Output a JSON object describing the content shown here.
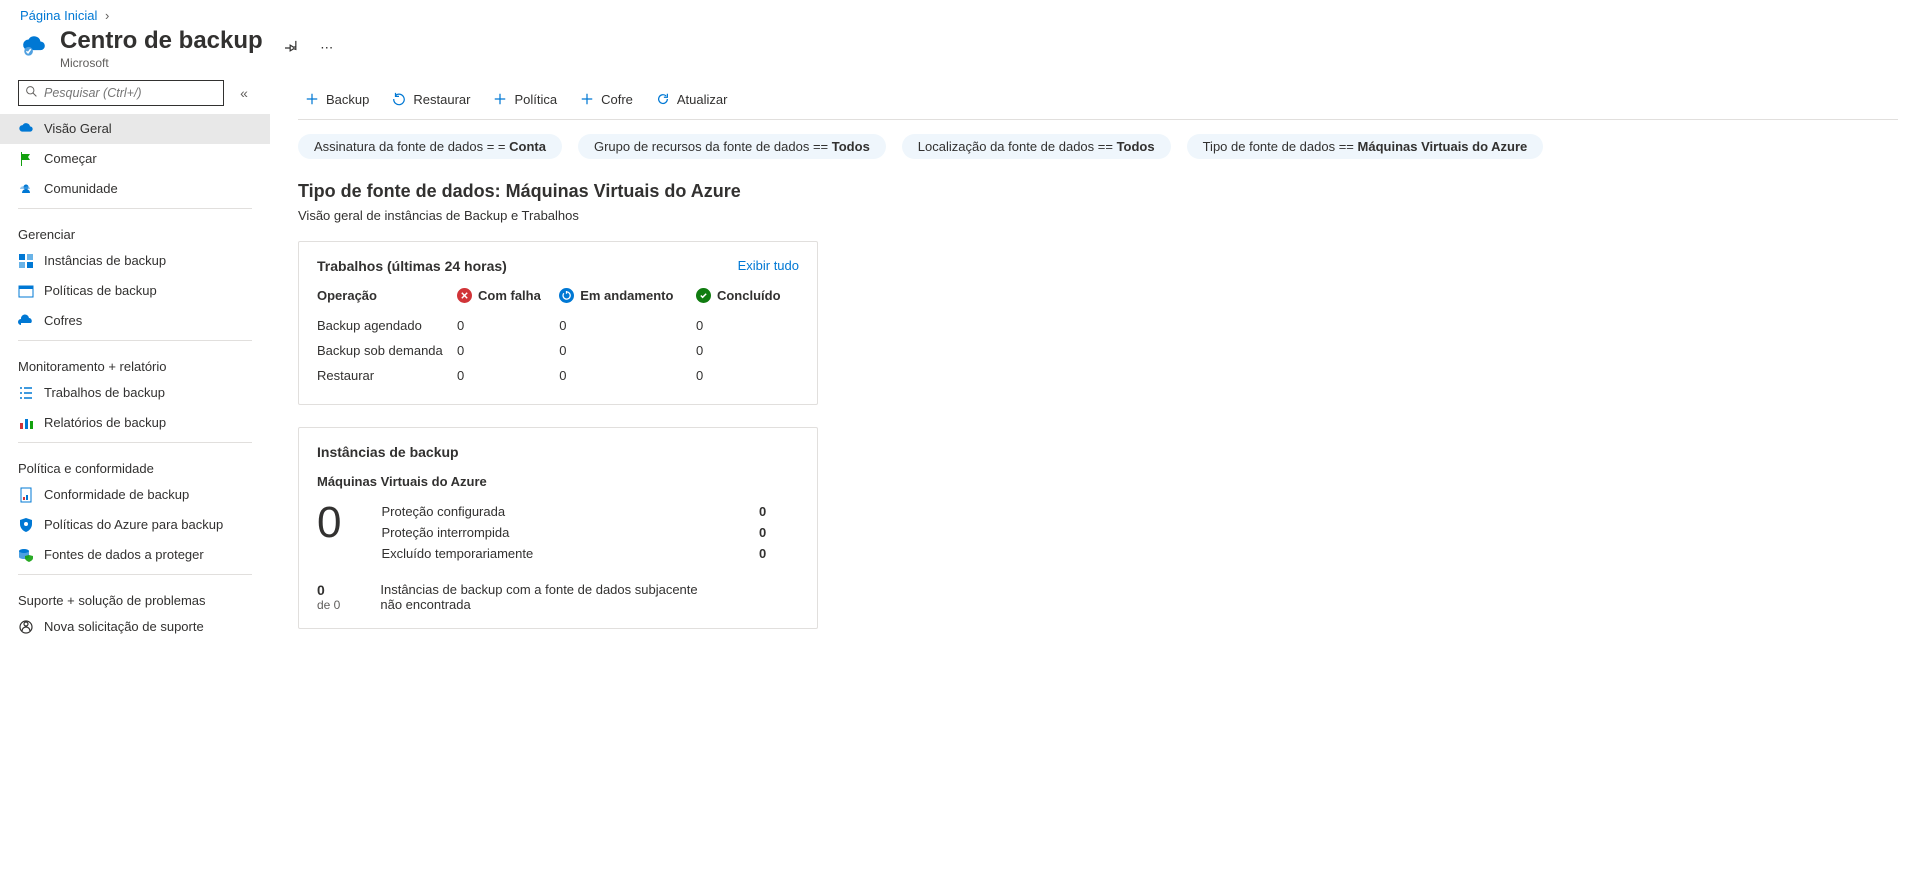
{
  "breadcrumb": {
    "home": "Página Inicial"
  },
  "header": {
    "title": "Centro de backup",
    "subtitle": "Microsoft"
  },
  "sidebar": {
    "search_placeholder": "Pesquisar (Ctrl+/)",
    "top": [
      {
        "label": "Visão Geral",
        "icon": "cloud-backup"
      },
      {
        "label": "Começar",
        "icon": "flag"
      },
      {
        "label": "Comunidade",
        "icon": "people-cloud"
      }
    ],
    "groups": [
      {
        "label": "Gerenciar",
        "items": [
          {
            "label": "Instâncias de backup",
            "icon": "grid-blue"
          },
          {
            "label": "Políticas de backup",
            "icon": "calendar"
          },
          {
            "label": "Cofres",
            "icon": "vault"
          }
        ]
      },
      {
        "label": "Monitoramento + relatório",
        "items": [
          {
            "label": "Trabalhos de backup",
            "icon": "list-check"
          },
          {
            "label": "Relatórios de backup",
            "icon": "bar-chart"
          }
        ]
      },
      {
        "label": "Política e conformidade",
        "items": [
          {
            "label": "Conformidade de backup",
            "icon": "report"
          },
          {
            "label": "Políticas do Azure para backup",
            "icon": "shield-gear"
          },
          {
            "label": "Fontes de dados a proteger",
            "icon": "db-shield"
          }
        ]
      },
      {
        "label": "Suporte + solução de problemas",
        "items": [
          {
            "label": "Nova solicitação de suporte",
            "icon": "support"
          }
        ]
      }
    ]
  },
  "commands": {
    "backup": "Backup",
    "restore": "Restaurar",
    "policy": "Política",
    "vault": "Cofre",
    "refresh": "Atualizar"
  },
  "filters": [
    {
      "label": "Assinatura da fonte de dados = = ",
      "value": "Conta"
    },
    {
      "label": "Grupo de recursos da fonte de dados == ",
      "value": "Todos"
    },
    {
      "label": "Localização da fonte de dados == ",
      "value": "Todos"
    },
    {
      "label": "Tipo de fonte de dados == ",
      "value": "Máquinas Virtuais do Azure"
    }
  ],
  "section": {
    "title": "Tipo de fonte de dados: Máquinas Virtuais do Azure",
    "subtitle": "Visão geral de instâncias de Backup e Trabalhos"
  },
  "jobs_card": {
    "title": "Trabalhos (últimas 24 horas)",
    "view_all": "Exibir tudo",
    "col_operation": "Operação",
    "col_failed": "Com falha",
    "col_inprogress": "Em andamento",
    "col_done": "Concluído",
    "rows": [
      {
        "op": "Backup agendado",
        "failed": "0",
        "inprog": "0",
        "done": "0"
      },
      {
        "op": "Backup sob demanda",
        "failed": "0",
        "inprog": "0",
        "done": "0"
      },
      {
        "op": "Restaurar",
        "failed": "0",
        "inprog": "0",
        "done": "0"
      }
    ]
  },
  "instances_card": {
    "title": "Instâncias de backup",
    "subtype": "Máquinas Virtuais do Azure",
    "big_count": "0",
    "rows": [
      {
        "label": "Proteção configurada",
        "value": "0"
      },
      {
        "label": "Proteção interrompida",
        "value": "0"
      },
      {
        "label": "Excluído temporariamente",
        "value": "0"
      }
    ],
    "footer_count": "0",
    "footer_count_sub": "de 0",
    "footer_msg": "Instâncias de backup com a fonte de dados subjacente não encontrada"
  }
}
